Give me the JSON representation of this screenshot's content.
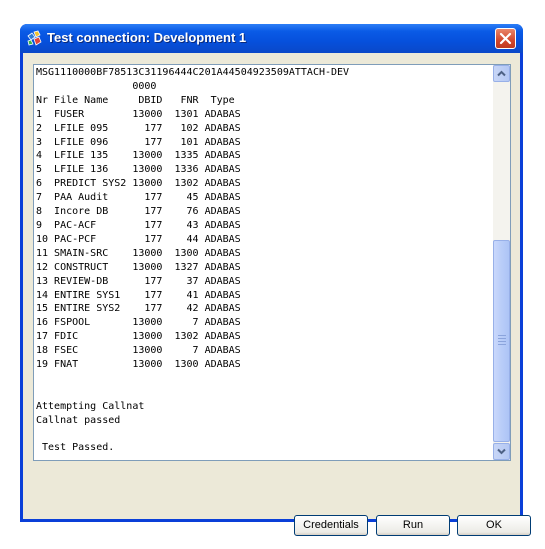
{
  "window": {
    "title": "Test connection: Development 1"
  },
  "output": {
    "lines": [
      "MSG1110000BF78513C31196444C201A44504923509ATTACH-DEV",
      "                0000",
      "Nr File Name     DBID   FNR  Type",
      "1  FUSER        13000  1301 ADABAS",
      "2  LFILE 095      177   102 ADABAS",
      "3  LFILE 096      177   101 ADABAS",
      "4  LFILE 135    13000  1335 ADABAS",
      "5  LFILE 136    13000  1336 ADABAS",
      "6  PREDICT SYS2 13000  1302 ADABAS",
      "7  PAA Audit      177    45 ADABAS",
      "8  Incore DB      177    76 ADABAS",
      "9  PAC-ACF        177    43 ADABAS",
      "10 PAC-PCF        177    44 ADABAS",
      "11 SMAIN-SRC    13000  1300 ADABAS",
      "12 CONSTRUCT    13000  1327 ADABAS",
      "13 REVIEW-DB      177    37 ADABAS",
      "14 ENTIRE SYS1    177    41 ADABAS",
      "15 ENTIRE SYS2    177    42 ADABAS",
      "16 FSPOOL       13000     7 ADABAS",
      "17 FDIC         13000  1302 ADABAS",
      "18 FSEC         13000     7 ADABAS",
      "19 FNAT         13000  1300 ADABAS",
      "",
      "",
      "Attempting Callnat",
      "Callnat passed",
      "",
      " Test Passed."
    ]
  },
  "buttons": {
    "credentials": "Credentials",
    "run": "Run",
    "ok": "OK"
  },
  "icons": {
    "title": "connection-gems-icon",
    "close": "close-x-icon",
    "scroll_up": "arrow-up-icon",
    "scroll_down": "arrow-down-icon"
  },
  "colors": {
    "titlebar": "#0a5be6",
    "close": "#d2472c",
    "dialog_bg": "#ece9d8",
    "button_border": "#003c74"
  }
}
